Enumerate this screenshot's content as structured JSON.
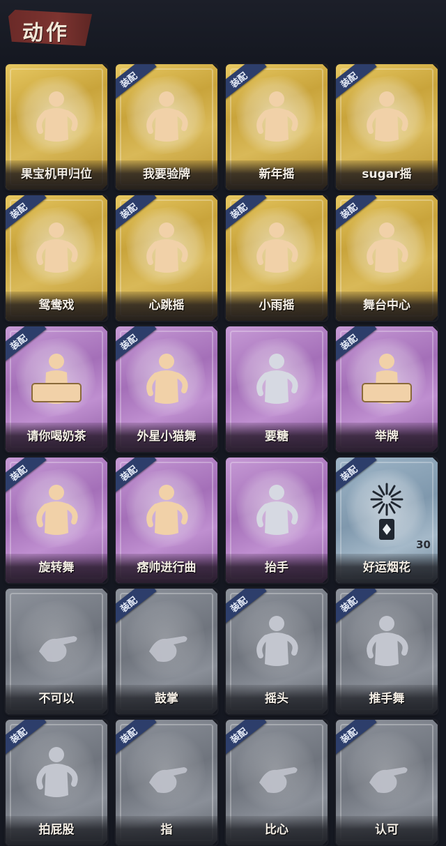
{
  "title": "动作",
  "badge_label": "装配",
  "colors": {
    "gold": "#d3b04b",
    "purple": "#b07cc3",
    "blue": "#8ea5b8",
    "gray": "#7c818a",
    "badge": "#2d3e6b",
    "silhouette": "#f1d1a8"
  },
  "cards": [
    {
      "label": "果宝机甲归位",
      "tier": "gold",
      "equipped": false,
      "icon": "dance-pose-icon"
    },
    {
      "label": "我要验牌",
      "tier": "gold",
      "equipped": true,
      "icon": "card-check-pose-icon"
    },
    {
      "label": "新年摇",
      "tier": "gold",
      "equipped": true,
      "icon": "new-year-shake-pose-icon"
    },
    {
      "label": "sugar摇",
      "tier": "gold",
      "equipped": true,
      "icon": "sugar-shake-pose-icon"
    },
    {
      "label": "鸳鸯戏",
      "tier": "gold",
      "equipped": true,
      "icon": "opera-pose-icon"
    },
    {
      "label": "心跳摇",
      "tier": "gold",
      "equipped": true,
      "icon": "heartbeat-shake-pose-icon"
    },
    {
      "label": "小雨摇",
      "tier": "gold",
      "equipped": true,
      "icon": "rain-shake-pose-icon"
    },
    {
      "label": "舞台中心",
      "tier": "gold",
      "equipped": true,
      "icon": "center-stage-pose-icon"
    },
    {
      "label": "请你喝奶茶",
      "tier": "purple",
      "equipped": true,
      "icon": "milk-tea-sign-pose-icon"
    },
    {
      "label": "外星小猫舞",
      "tier": "purple",
      "equipped": true,
      "icon": "alien-cat-dance-pose-icon"
    },
    {
      "label": "要糖",
      "tier": "purple",
      "equipped": false,
      "icon": "ask-candy-pose-icon"
    },
    {
      "label": "举牌",
      "tier": "purple",
      "equipped": true,
      "icon": "hold-sign-pose-icon"
    },
    {
      "label": "旋转舞",
      "tier": "purple",
      "equipped": true,
      "icon": "spin-dance-pose-icon"
    },
    {
      "label": "痞帅进行曲",
      "tier": "purple",
      "equipped": true,
      "icon": "cool-march-pose-icon"
    },
    {
      "label": "抬手",
      "tier": "purple",
      "equipped": false,
      "icon": "raise-hand-pose-icon"
    },
    {
      "label": "好运烟花",
      "tier": "blue",
      "equipped": true,
      "icon": "firework-icon",
      "count": "30"
    },
    {
      "label": "不可以",
      "tier": "gray",
      "equipped": false,
      "icon": "finger-no-icon"
    },
    {
      "label": "鼓掌",
      "tier": "gray",
      "equipped": true,
      "icon": "clap-icon"
    },
    {
      "label": "摇头",
      "tier": "gray",
      "equipped": true,
      "icon": "shake-head-pose-icon"
    },
    {
      "label": "推手舞",
      "tier": "gray",
      "equipped": true,
      "icon": "push-hand-dance-pose-icon"
    },
    {
      "label": "拍屁股",
      "tier": "gray",
      "equipped": true,
      "icon": "pat-butt-pose-icon"
    },
    {
      "label": "指",
      "tier": "gray",
      "equipped": true,
      "icon": "point-hand-icon"
    },
    {
      "label": "比心",
      "tier": "gray",
      "equipped": true,
      "icon": "finger-heart-icon"
    },
    {
      "label": "认可",
      "tier": "gray",
      "equipped": true,
      "icon": "thumbs-up-icon"
    }
  ]
}
